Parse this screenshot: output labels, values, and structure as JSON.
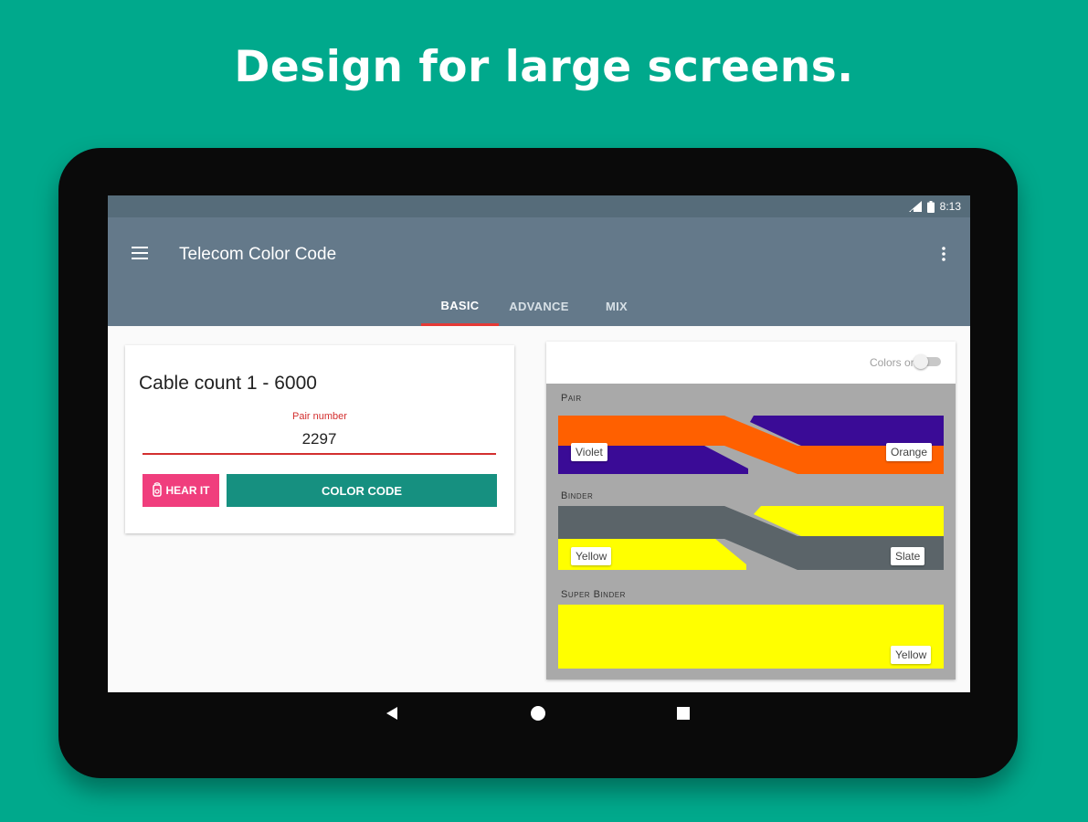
{
  "headline": "Design for large screens.",
  "statusbar": {
    "time": "8:13",
    "signal_icon": "signal-icon",
    "battery_icon": "battery-icon"
  },
  "appbar": {
    "title": "Telecom Color Code",
    "menu_icon": "menu-icon",
    "overflow_icon": "overflow-icon",
    "tabs": [
      {
        "label": "BASIC",
        "active": true
      },
      {
        "label": "ADVANCE",
        "active": false
      },
      {
        "label": "MIX",
        "active": false
      }
    ]
  },
  "calculator": {
    "cable_count": "Cable count 1 - 6000",
    "pair_label": "Pair number",
    "pair_value": "2297",
    "hear_label": "HEAR IT",
    "color_code_label": "COLOR CODE"
  },
  "result": {
    "colors_only_label": "Colors only",
    "colors_only_on": false,
    "pair": {
      "label": "Pair",
      "tip": "Violet",
      "ring": "Orange",
      "tip_color": "#3a0b96",
      "ring_color": "#ff6000"
    },
    "binder": {
      "label": "Binder",
      "tip": "Yellow",
      "ring": "Slate",
      "tip_color": "#ffff00",
      "ring_color": "#5b6469"
    },
    "super_binder": {
      "label": "Super Binder",
      "color_name": "Yellow",
      "color": "#ffff00"
    }
  },
  "colors": {
    "background": "#00a98c",
    "appbar": "#64798a",
    "accent": "#e53935",
    "hear_button": "#f03e7d",
    "color_code_button": "#169080"
  },
  "navbar": {
    "back_icon": "back-icon",
    "home_icon": "home-icon",
    "recents_icon": "recents-icon"
  }
}
